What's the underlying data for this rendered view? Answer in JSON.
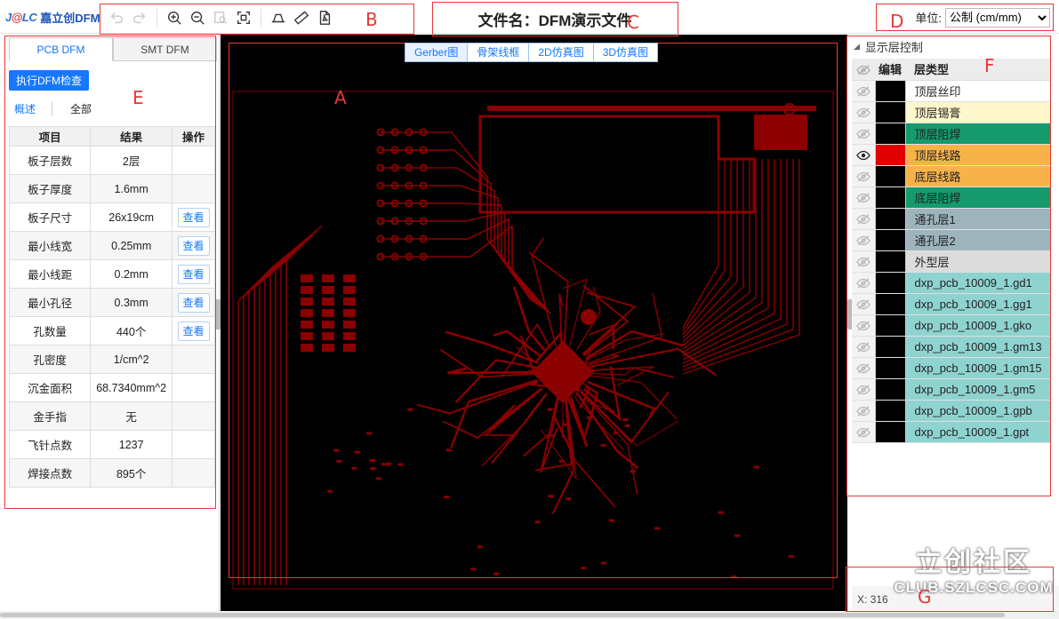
{
  "app": {
    "logo_mark_a": "J",
    "logo_mark_b": "@",
    "logo_mark_c": "LC",
    "logo_name": "嘉立创DFM"
  },
  "toolbar": {
    "icons": [
      "undo-icon",
      "redo-icon",
      "zoom-in-icon",
      "zoom-out-icon",
      "zoom-window-icon",
      "fit-view-icon",
      "measure-board-icon",
      "ruler-icon",
      "export-pdf-icon"
    ]
  },
  "file_title": "文件名：DFM演示文件",
  "unit": {
    "label": "单位:",
    "selected": "公制 (cm/mm)"
  },
  "left_panel": {
    "tabs": [
      {
        "label": "PCB DFM"
      },
      {
        "label": "SMT DFM"
      }
    ],
    "run_button": "执行DFM检查",
    "subtabs": [
      {
        "label": "概述"
      },
      {
        "label": "全部"
      }
    ],
    "table": {
      "headers": [
        "项目",
        "结果",
        "操作"
      ],
      "rows": [
        {
          "item": "板子层数",
          "result": "2层",
          "action": ""
        },
        {
          "item": "板子厚度",
          "result": "1.6mm",
          "action": ""
        },
        {
          "item": "板子尺寸",
          "result": "26x19cm",
          "action": "查看"
        },
        {
          "item": "最小线宽",
          "result": "0.25mm",
          "action": "查看"
        },
        {
          "item": "最小线距",
          "result": "0.2mm",
          "action": "查看"
        },
        {
          "item": "最小孔径",
          "result": "0.3mm",
          "action": "查看"
        },
        {
          "item": "孔数量",
          "result": "440个",
          "action": "查看"
        },
        {
          "item": "孔密度",
          "result": "1/cm^2",
          "action": ""
        },
        {
          "item": "沉金面积",
          "result": "68.7340mm^2",
          "action": ""
        },
        {
          "item": "金手指",
          "result": "无",
          "action": ""
        },
        {
          "item": "飞针点数",
          "result": "1237",
          "action": ""
        },
        {
          "item": "焊接点数",
          "result": "895个",
          "action": ""
        }
      ]
    }
  },
  "canvas": {
    "view_tabs": [
      {
        "label": "Gerber图"
      },
      {
        "label": "骨架线框"
      },
      {
        "label": "2D仿真图"
      },
      {
        "label": "3D仿真图"
      }
    ],
    "trace_color": "#8b0000",
    "background": "#000000"
  },
  "layers": {
    "header": "显示层控制",
    "columns": [
      "编辑",
      "层类型"
    ],
    "items": [
      {
        "name": "顶层丝印",
        "bg": "#ffffff",
        "swatch": "#000000",
        "visible": false
      },
      {
        "name": "顶层锡膏",
        "bg": "#fff7cc",
        "swatch": "#000000",
        "visible": false
      },
      {
        "name": "顶层阻焊",
        "bg": "#159a6e",
        "swatch": "#000000",
        "visible": false
      },
      {
        "name": "顶层线路",
        "bg": "#f7b34a",
        "swatch": "#e00000",
        "visible": true
      },
      {
        "name": "底层线路",
        "bg": "#f7b34a",
        "swatch": "#000000",
        "visible": false
      },
      {
        "name": "底层阻焊",
        "bg": "#159a6e",
        "swatch": "#000000",
        "visible": false
      },
      {
        "name": "通孔层1",
        "bg": "#9db4bd",
        "swatch": "#000000",
        "visible": false
      },
      {
        "name": "通孔层2",
        "bg": "#9db4bd",
        "swatch": "#000000",
        "visible": false
      },
      {
        "name": "外型层",
        "bg": "#dcdcdc",
        "swatch": "#000000",
        "visible": false
      },
      {
        "name": "dxp_pcb_10009_1.gd1",
        "bg": "#8fd3d0",
        "swatch": "#000000",
        "visible": false
      },
      {
        "name": "dxp_pcb_10009_1.gg1",
        "bg": "#8fd3d0",
        "swatch": "#000000",
        "visible": false
      },
      {
        "name": "dxp_pcb_10009_1.gko",
        "bg": "#8fd3d0",
        "swatch": "#000000",
        "visible": false
      },
      {
        "name": "dxp_pcb_10009_1.gm13",
        "bg": "#8fd3d0",
        "swatch": "#000000",
        "visible": false
      },
      {
        "name": "dxp_pcb_10009_1.gm15",
        "bg": "#8fd3d0",
        "swatch": "#000000",
        "visible": false
      },
      {
        "name": "dxp_pcb_10009_1.gm5",
        "bg": "#8fd3d0",
        "swatch": "#000000",
        "visible": false
      },
      {
        "name": "dxp_pcb_10009_1.gpb",
        "bg": "#8fd3d0",
        "swatch": "#000000",
        "visible": false
      },
      {
        "name": "dxp_pcb_10009_1.gpt",
        "bg": "#8fd3d0",
        "swatch": "#000000",
        "visible": false
      }
    ]
  },
  "status": {
    "coords": "X: 316"
  },
  "watermark": {
    "line1": "立创社区",
    "line2": "CLUB.SZLCSC.COM"
  },
  "annotations": {
    "A": "A",
    "B": "B",
    "C": "C",
    "D": "D",
    "E": "E",
    "F": "F",
    "G": "G"
  }
}
